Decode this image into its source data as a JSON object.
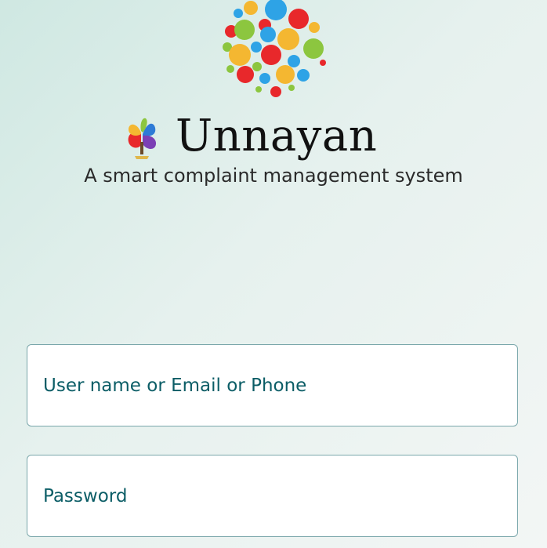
{
  "branding": {
    "app_name": "Unnayan",
    "tagline": "A smart complaint management system"
  },
  "form": {
    "username": {
      "placeholder": "User name or Email or Phone",
      "value": ""
    },
    "password": {
      "placeholder": "Password",
      "value": ""
    }
  },
  "colors": {
    "field_text": "#0b5d66",
    "field_border": "#7aa7ab",
    "background_start": "#cfe8e2",
    "background_end": "#f3f6f5"
  },
  "icons": {
    "top_logo": "colorful-bubbles-logo",
    "brand_logo": "rainbow-tree-logo"
  }
}
